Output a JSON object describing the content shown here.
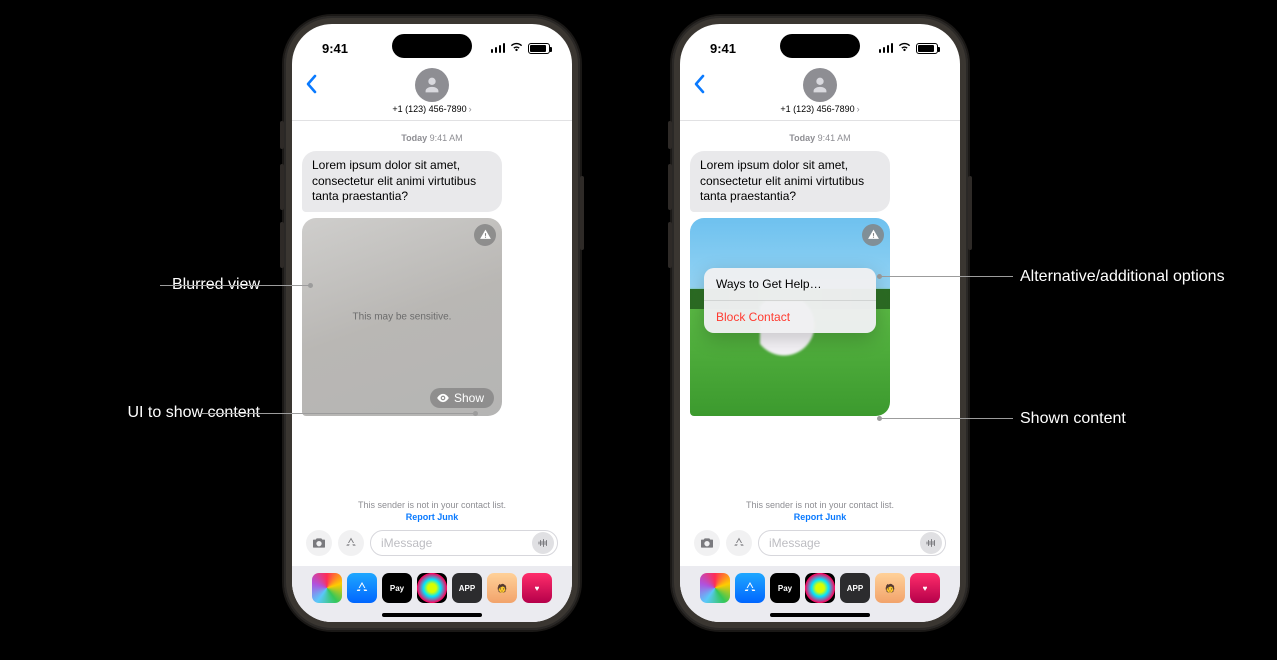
{
  "status": {
    "time": "9:41"
  },
  "header": {
    "contact": "+1 (123) 456-7890"
  },
  "convo": {
    "timestamp_day": "Today",
    "timestamp_time": "9:41 AM",
    "message_text": "Lorem ipsum dolor sit amet, consectetur elit animi virtutibus tanta praestantia?",
    "sensitive_label": "This may be sensitive.",
    "show_label": "Show"
  },
  "popup": {
    "help": "Ways to Get Help…",
    "block": "Block Contact"
  },
  "footer": {
    "sender_note": "This sender is not in your contact list.",
    "report": "Report Junk",
    "placeholder": "iMessage"
  },
  "dock": {
    "photos": "",
    "appstore": "",
    "applepay": "Pay",
    "fitness": "",
    "app": "APP",
    "memoji": "",
    "heart": ""
  },
  "callouts": {
    "blurred": "Blurred view",
    "show_ui": "UI to show content",
    "alt_options": "Alternative/additional options",
    "shown": "Shown content"
  }
}
